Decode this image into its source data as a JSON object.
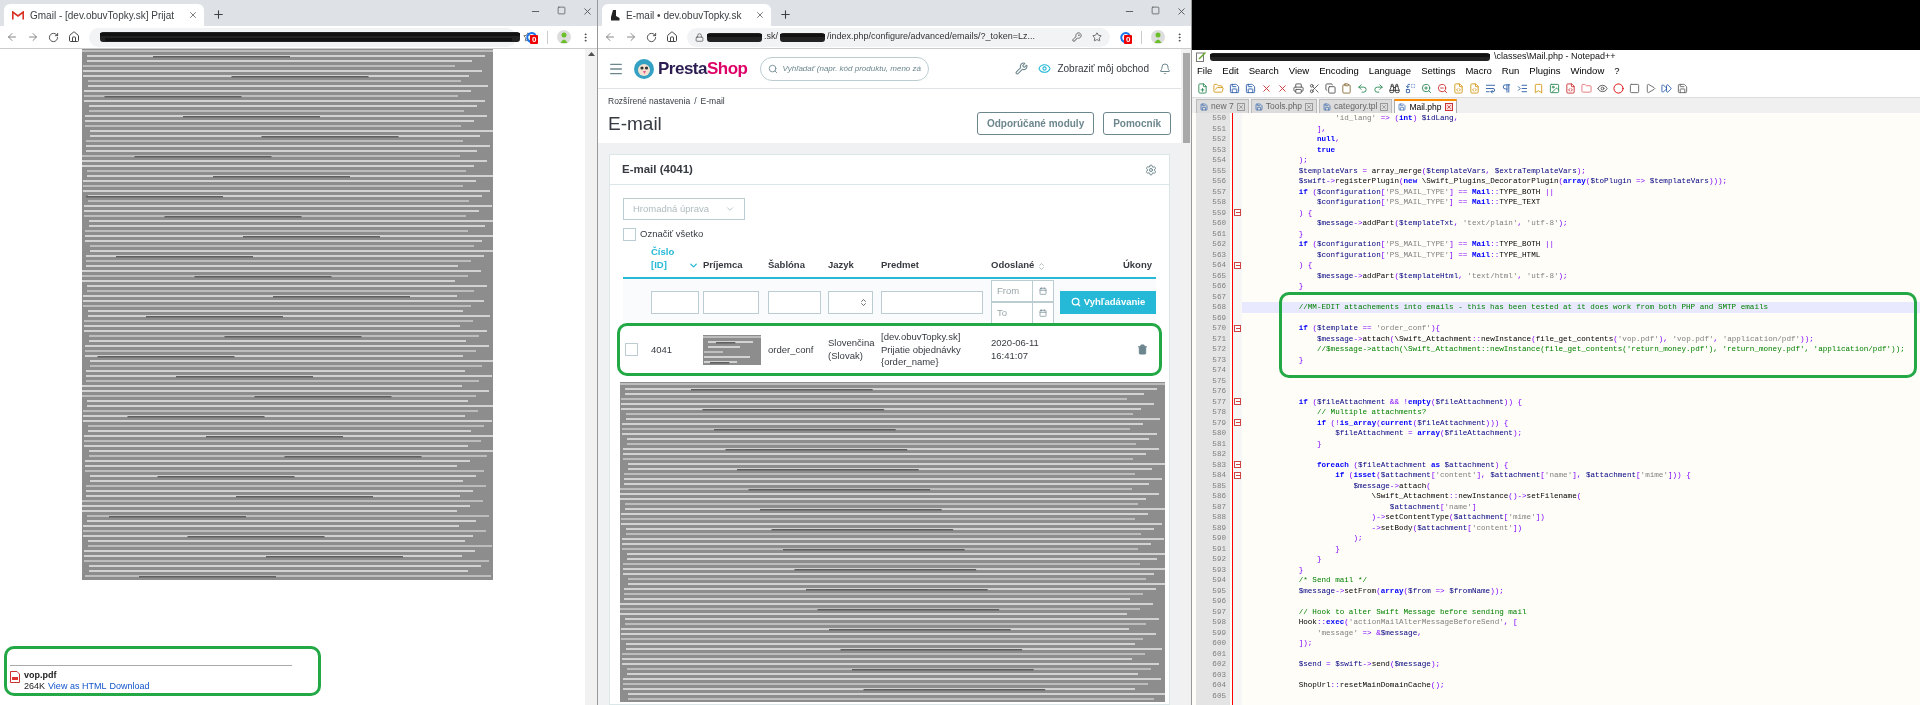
{
  "gmail_window": {
    "tab_title": "Gmail - [dev.obuvTopky.sk] Prijat",
    "extension_badge": "0",
    "attachment": {
      "name": "vop.pdf",
      "size": "264K",
      "view_link": "View as HTML",
      "download_link": "Download"
    }
  },
  "prestashop_window": {
    "tab_title": "E-mail • dev.obuvTopky.sk",
    "url_parts": [
      ".sk/",
      "/index.php/configure/advanced/emails/?_token=Lz..."
    ],
    "extension_badge": "0",
    "brand": {
      "first": "Presta",
      "second": "Shop"
    },
    "search_placeholder": "Vyhľadať (napr. kód produktu, meno zá",
    "store_link": "Zobraziť môj obchod",
    "breadcrumb": {
      "items": [
        "Rozšírené nastavenia",
        "E-mail"
      ],
      "separator": "/"
    },
    "title": "E-mail",
    "buttons": [
      "Odporúčané moduly",
      "Pomocník"
    ],
    "panel": {
      "title": "E-mail (4041)",
      "bulk_action": "Hromadná úprava",
      "select_all": {
        "label": "Označiť všetko",
        "checked": false
      },
      "columns": [
        {
          "lines": [
            "Číslo",
            "[ID]"
          ],
          "sortable": true,
          "sort_active": true
        },
        {
          "lines": [
            "Príjemca"
          ],
          "sortable": false,
          "sort_active": false
        },
        {
          "lines": [
            "Šablóna"
          ],
          "sortable": false,
          "sort_active": false
        },
        {
          "lines": [
            "Jazyk"
          ],
          "sortable": false,
          "sort_active": false
        },
        {
          "lines": [
            "Predmet"
          ],
          "sortable": false,
          "sort_active": false
        },
        {
          "lines": [
            "Odoslané"
          ],
          "sortable": true,
          "sort_active": false
        },
        {
          "lines": [
            "Úkony"
          ],
          "sortable": false,
          "sort_active": false
        }
      ],
      "filters": {
        "date_from_placeholder": "From",
        "date_to_placeholder": "To",
        "search_button": "Vyhľadávanie"
      },
      "rows": [
        {
          "checked": false,
          "id": "4041",
          "template": "order_conf",
          "language": [
            "Slovenčina",
            "(Slovak)"
          ],
          "subject": [
            "[dev.obuvTopky.sk]",
            "Prijatie objednávky",
            "{order_name}"
          ],
          "sent": [
            "2020-06-11",
            "16:41:07"
          ]
        }
      ]
    }
  },
  "notepad_window": {
    "title": "\\classes\\Mail.php - Notepad++",
    "menu": [
      "File",
      "Edit",
      "Search",
      "View",
      "Encoding",
      "Language",
      "Settings",
      "Macro",
      "Run",
      "Plugins",
      "Window",
      "?"
    ],
    "tabs": [
      {
        "label": "new 7",
        "selected": false
      },
      {
        "label": "Tools.php",
        "selected": false
      },
      {
        "label": "category.tpl",
        "selected": false
      },
      {
        "label": "Mail.php",
        "selected": true
      }
    ],
    "lines": [
      {
        "number": "550",
        "text": "                    'id_lang' => (int) $idLang,",
        "fold": false,
        "current": false
      },
      {
        "number": "551",
        "text": "                ],",
        "fold": false,
        "current": false
      },
      {
        "number": "552",
        "text": "                null,",
        "fold": false,
        "current": false
      },
      {
        "number": "553",
        "text": "                true",
        "fold": false,
        "current": false
      },
      {
        "number": "554",
        "text": "            );",
        "fold": false,
        "current": false
      },
      {
        "number": "555",
        "text": "            $templateVars = array_merge($templateVars, $extraTemplateVars);",
        "fold": false,
        "current": false
      },
      {
        "number": "556",
        "text": "            $swift->registerPlugin(new \\Swift_Plugins_DecoratorPlugin(array($toPlugin => $templateVars)));",
        "fold": false,
        "current": false
      },
      {
        "number": "557",
        "text": "            if ($configuration['PS_MAIL_TYPE'] == Mail::TYPE_BOTH ||",
        "fold": false,
        "current": false
      },
      {
        "number": "558",
        "text": "                $configuration['PS_MAIL_TYPE'] == Mail::TYPE_TEXT",
        "fold": false,
        "current": false
      },
      {
        "number": "559",
        "text": "            ) {",
        "fold": true,
        "current": false
      },
      {
        "number": "560",
        "text": "                $message->addPart($templateTxt, 'text/plain', 'utf-8');",
        "fold": false,
        "current": false
      },
      {
        "number": "561",
        "text": "            }",
        "fold": false,
        "current": false
      },
      {
        "number": "562",
        "text": "            if ($configuration['PS_MAIL_TYPE'] == Mail::TYPE_BOTH ||",
        "fold": false,
        "current": false
      },
      {
        "number": "563",
        "text": "                $configuration['PS_MAIL_TYPE'] == Mail::TYPE_HTML",
        "fold": false,
        "current": false
      },
      {
        "number": "564",
        "text": "            ) {",
        "fold": true,
        "current": false
      },
      {
        "number": "565",
        "text": "                $message->addPart($templateHtml, 'text/html', 'utf-8');",
        "fold": false,
        "current": false
      },
      {
        "number": "566",
        "text": "            }",
        "fold": false,
        "current": false
      },
      {
        "number": "567",
        "fold": false,
        "current": false
      },
      {
        "number": "568",
        "text": "            //MM-EDIT attachements into emails - this has been tested at it does work from both PHP and SMTP emails",
        "fold": false,
        "current": true
      },
      {
        "number": "569",
        "fold": false,
        "current": false
      },
      {
        "number": "570",
        "text": "            if ($template == 'order_conf'){",
        "fold": true,
        "current": false
      },
      {
        "number": "571",
        "text": "                $message->attach(\\Swift_Attachment::newInstance(file_get_contents('vop.pdf'), 'vop.pdf', 'application/pdf'));",
        "fold": false,
        "current": false
      },
      {
        "number": "572",
        "text": "                //$message->attach(\\Swift_Attachment::newInstance(file_get_contents('return_money.pdf'), 'return_money.pdf', 'application/pdf'));",
        "fold": false,
        "current": false
      },
      {
        "number": "573",
        "text": "            }",
        "fold": false,
        "current": false
      },
      {
        "number": "574",
        "fold": false,
        "current": false
      },
      {
        "number": "575",
        "fold": false,
        "current": false
      },
      {
        "number": "576",
        "fold": false,
        "current": false
      },
      {
        "number": "577",
        "text": "            if ($fileAttachment && !empty($fileAttachment)) {",
        "fold": true,
        "current": false
      },
      {
        "number": "578",
        "text": "                // Multiple attachments?",
        "fold": false,
        "current": false
      },
      {
        "number": "579",
        "text": "                if (!is_array(current($fileAttachment))) {",
        "fold": true,
        "current": false
      },
      {
        "number": "580",
        "text": "                    $fileAttachment = array($fileAttachment);",
        "fold": false,
        "current": false
      },
      {
        "number": "581",
        "text": "                }",
        "fold": false,
        "current": false
      },
      {
        "number": "582",
        "fold": false,
        "current": false
      },
      {
        "number": "583",
        "text": "                foreach ($fileAttachment as $attachment) {",
        "fold": true,
        "current": false
      },
      {
        "number": "584",
        "text": "                    if (isset($attachment['content'], $attachment['name'], $attachment['mime'])) {",
        "fold": true,
        "current": false
      },
      {
        "number": "585",
        "text": "                        $message->attach(",
        "fold": false,
        "current": false
      },
      {
        "number": "586",
        "text": "                            \\Swift_Attachment::newInstance()->setFilename(",
        "fold": false,
        "current": false
      },
      {
        "number": "587",
        "text": "                                $attachment['name']",
        "fold": false,
        "current": false
      },
      {
        "number": "588",
        "text": "                            )->setContentType($attachment['mime'])",
        "fold": false,
        "current": false
      },
      {
        "number": "589",
        "text": "                            ->setBody($attachment['content'])",
        "fold": false,
        "current": false
      },
      {
        "number": "590",
        "text": "                        );",
        "fold": false,
        "current": false
      },
      {
        "number": "591",
        "text": "                    }",
        "fold": false,
        "current": false
      },
      {
        "number": "592",
        "text": "                }",
        "fold": false,
        "current": false
      },
      {
        "number": "593",
        "text": "            }",
        "fold": false,
        "current": false
      },
      {
        "number": "594",
        "text": "            /* Send mail */",
        "fold": false,
        "current": false
      },
      {
        "number": "595",
        "text": "            $message->setFrom(array($from => $fromName));",
        "fold": false,
        "current": false
      },
      {
        "number": "596",
        "fold": false,
        "current": false
      },
      {
        "number": "597",
        "text": "            // Hook to alter Swift Message before sending mail",
        "fold": false,
        "current": false
      },
      {
        "number": "598",
        "text": "            Hook::exec('actionMailAlterMessageBeforeSend', [",
        "fold": false,
        "current": false
      },
      {
        "number": "599",
        "text": "                'message' => &$message,",
        "fold": false,
        "current": false
      },
      {
        "number": "600",
        "text": "            ]);",
        "fold": false,
        "current": false
      },
      {
        "number": "601",
        "fold": false,
        "current": false
      },
      {
        "number": "602",
        "text": "            $send = $swift->send($message);",
        "fold": false,
        "current": false
      },
      {
        "number": "603",
        "fold": false,
        "current": false
      },
      {
        "number": "604",
        "text": "            ShopUrl::resetMainDomainCache();",
        "fold": false,
        "current": false
      },
      {
        "number": "605",
        "fold": false,
        "current": false
      }
    ]
  }
}
